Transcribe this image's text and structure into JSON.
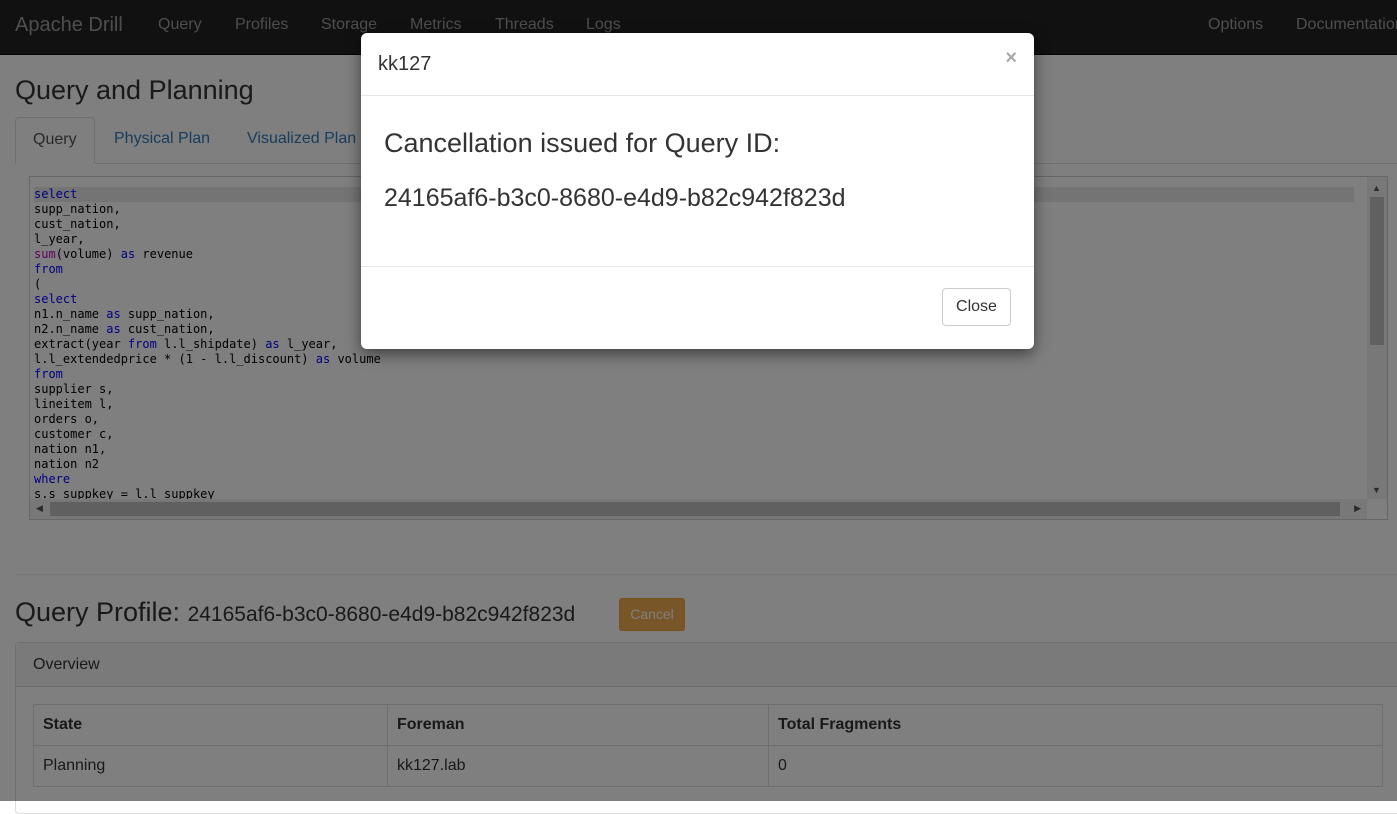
{
  "navbar": {
    "brand": "Apache Drill",
    "items": [
      "Query",
      "Profiles",
      "Storage",
      "Metrics",
      "Threads",
      "Logs"
    ],
    "right_items": [
      "Options",
      "Documentation"
    ]
  },
  "page": {
    "title": "Query and Planning",
    "tabs": [
      "Query",
      "Physical Plan",
      "Visualized Plan"
    ],
    "active_tab": "Query"
  },
  "editor": {
    "lines": [
      [
        {
          "t": "select",
          "c": "kw"
        }
      ],
      [
        {
          "t": "supp_nation,"
        }
      ],
      [
        {
          "t": "cust_nation,"
        }
      ],
      [
        {
          "t": "l_year,"
        }
      ],
      [
        {
          "t": "sum",
          "c": "fn"
        },
        {
          "t": "(volume) "
        },
        {
          "t": "as",
          "c": "kw"
        },
        {
          "t": " revenue"
        }
      ],
      [
        {
          "t": "from",
          "c": "kw"
        }
      ],
      [
        {
          "t": "("
        }
      ],
      [
        {
          "t": "select",
          "c": "kw"
        }
      ],
      [
        {
          "t": "n1.n_name "
        },
        {
          "t": "as",
          "c": "kw"
        },
        {
          "t": " supp_nation,"
        }
      ],
      [
        {
          "t": "n2.n_name "
        },
        {
          "t": "as",
          "c": "kw"
        },
        {
          "t": " cust_nation,"
        }
      ],
      [
        {
          "t": "extract(year "
        },
        {
          "t": "from",
          "c": "kw"
        },
        {
          "t": " l.l_shipdate) "
        },
        {
          "t": "as",
          "c": "kw"
        },
        {
          "t": " l_year,"
        }
      ],
      [
        {
          "t": "l.l_extendedprice * (1 - l.l_discount) "
        },
        {
          "t": "as",
          "c": "kw"
        },
        {
          "t": " volume"
        }
      ],
      [
        {
          "t": "from",
          "c": "kw"
        }
      ],
      [
        {
          "t": "supplier s,"
        }
      ],
      [
        {
          "t": "lineitem l,"
        }
      ],
      [
        {
          "t": "orders o,"
        }
      ],
      [
        {
          "t": "customer c,"
        }
      ],
      [
        {
          "t": "nation n1,"
        }
      ],
      [
        {
          "t": "nation n2"
        }
      ],
      [
        {
          "t": "where",
          "c": "kw"
        }
      ],
      [
        {
          "t": "s.s_suppkey = l.l_suppkey"
        }
      ]
    ]
  },
  "profile": {
    "title": "Query Profile:",
    "query_id": "24165af6-b3c0-8680-e4d9-b82c942f823d",
    "cancel_label": "Cancel"
  },
  "overview": {
    "heading": "Overview",
    "columns": [
      "State",
      "Foreman",
      "Total Fragments"
    ],
    "row": [
      "Planning",
      "kk127.lab",
      "0"
    ]
  },
  "modal": {
    "title": "kk127",
    "close_symbol": "×",
    "message": "Cancellation issued for Query ID:",
    "query_id": "24165af6-b3c0-8680-e4d9-b82c942f823d",
    "close_label": "Close"
  },
  "colors": {
    "navbar_bg": "#222222",
    "link": "#337ab7",
    "cancel_btn": "#f0ad4e",
    "keyword": "#0000ff",
    "function": "#c000c0"
  }
}
